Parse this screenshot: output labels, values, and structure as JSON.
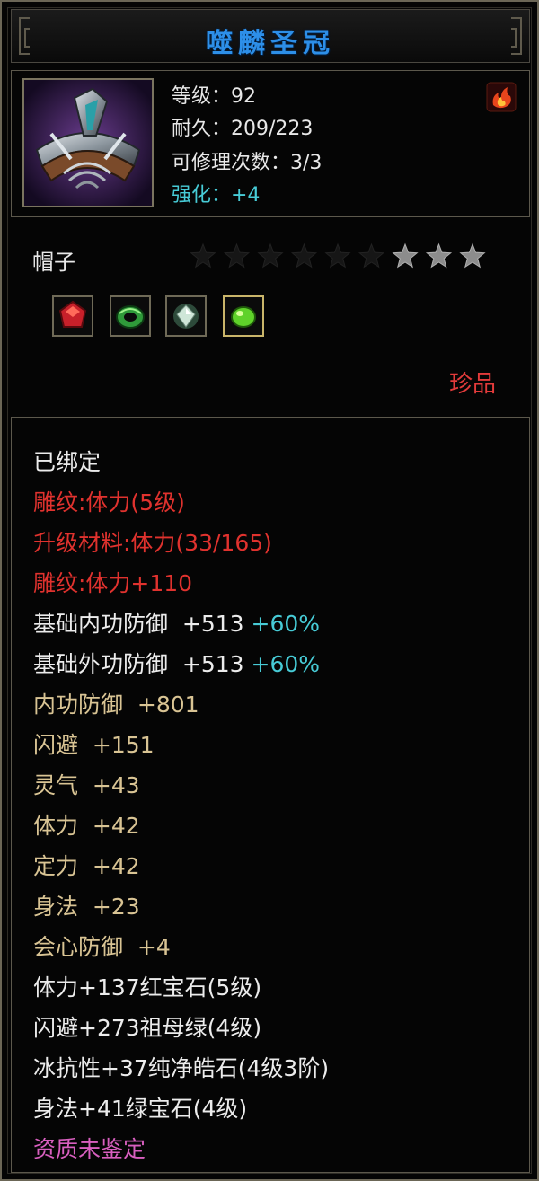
{
  "item": {
    "name": "噬麟圣冠",
    "stats": {
      "level": "等级：92",
      "durability": "耐久：209/223",
      "repair_count": "可修理次数：3/3",
      "refine": "强化：+4"
    },
    "type": "帽子",
    "stars_total": 9,
    "stars_lit": 3,
    "gems": [
      {
        "icon": "ruby-gem-icon",
        "color": "#c8202a"
      },
      {
        "icon": "jade-ring-gem-icon",
        "color": "#2f9a3a"
      },
      {
        "icon": "diamond-gem-icon",
        "color": "#cfe6d8"
      },
      {
        "icon": "peridot-gem-icon",
        "color": "#5fd22a"
      }
    ],
    "rarity": "珍品"
  },
  "attributes": {
    "bound": "已绑定",
    "engrave1": "雕纹:体力(5级)",
    "upgrade_material": "升级材料:体力(33/165)",
    "engrave2": "雕纹:体力+110",
    "base_inner_def": "基础内功防御  +513",
    "base_inner_def_pct": "+60%",
    "base_outer_def": "基础外功防御  +513",
    "base_outer_def_pct": "+60%",
    "inner_def": "内功防御  +801",
    "dodge": "闪避  +151",
    "spirit": "灵气  +43",
    "stamina": "体力  +42",
    "focus": "定力  +42",
    "agility": "身法  +23",
    "crit_def": "会心防御  +4",
    "gem1": "体力+137红宝石(5级)",
    "gem2": "闪避+273祖母绿(4级)",
    "gem3": "冰抗性+37纯净皓石(4级3阶)",
    "gem4": "身法+41绿宝石(4级)",
    "aptitude": "资质未鉴定"
  },
  "colors": {
    "title": "#2d8fe8",
    "refine": "#47cbd6",
    "red": "#e0322e",
    "gold": "#d9c494",
    "pink": "#d85fbf"
  }
}
